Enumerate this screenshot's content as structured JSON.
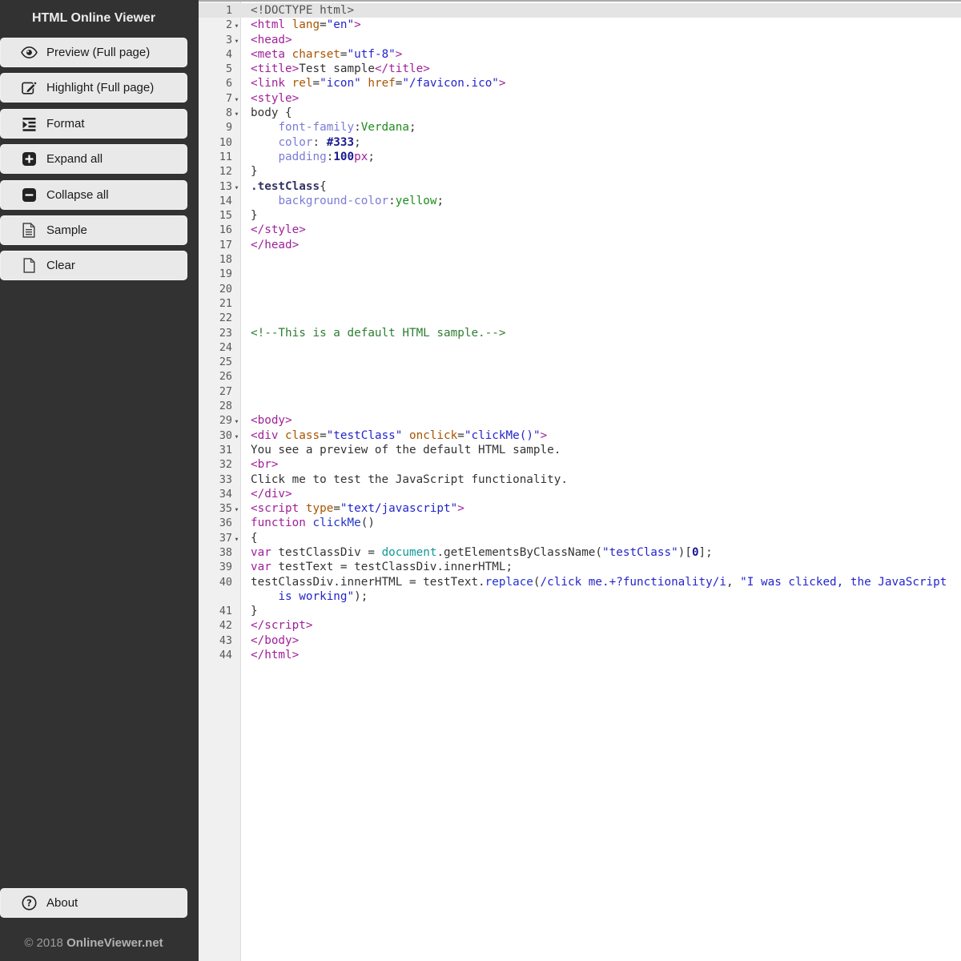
{
  "sidebar": {
    "title": "HTML Online Viewer",
    "buttons": [
      {
        "id": "preview",
        "icon": "eye-icon",
        "label": "Preview (Full page)"
      },
      {
        "id": "highlight",
        "icon": "edit-icon",
        "label": "Highlight (Full page)"
      },
      {
        "id": "format",
        "icon": "format-icon",
        "label": "Format"
      },
      {
        "id": "expand-all",
        "icon": "expand-icon",
        "label": "Expand all"
      },
      {
        "id": "collapse-all",
        "icon": "collapse-icon",
        "label": "Collapse all"
      },
      {
        "id": "sample",
        "icon": "sample-document-icon",
        "label": "Sample"
      },
      {
        "id": "clear",
        "icon": "blank-page-icon",
        "label": "Clear"
      }
    ],
    "about_button": {
      "id": "about",
      "icon": "question-icon",
      "label": "About"
    },
    "copyright": {
      "prefix": "© 2018 ",
      "site": "OnlineViewer.net"
    }
  },
  "editor": {
    "active_line": 1,
    "colors": {
      "tag": "#a0209a",
      "attribute": "#a85400",
      "string": "#2424cc",
      "comment": "#2e7d32",
      "css_property": "#7b7bd8",
      "css_value": "#1e8c1e",
      "number": "#1a1a90",
      "meta": "#555555",
      "selector": "#333366",
      "js_builtin": "#119999",
      "function_name": "#2233cc",
      "active_line_bg": "#e4e4e4",
      "gutter_bg": "#f0f0f0",
      "sidebar_bg": "#323232",
      "button_bg": "#e9e9e9"
    },
    "lines": [
      {
        "n": 1,
        "a": true,
        "t": [
          [
            "meta",
            "<!DOCTYPE html>"
          ]
        ]
      },
      {
        "n": 2,
        "f": true,
        "t": [
          [
            "tag",
            "<html "
          ],
          [
            "attr",
            "lang"
          ],
          [
            "plain",
            "="
          ],
          [
            "str",
            "\"en\""
          ],
          [
            "tag",
            ">"
          ]
        ]
      },
      {
        "n": 3,
        "f": true,
        "t": [
          [
            "tag",
            "<head>"
          ]
        ]
      },
      {
        "n": 4,
        "t": [
          [
            "tag",
            "<meta "
          ],
          [
            "attr",
            "charset"
          ],
          [
            "plain",
            "="
          ],
          [
            "str",
            "\"utf-8\""
          ],
          [
            "tag",
            ">"
          ]
        ]
      },
      {
        "n": 5,
        "t": [
          [
            "tag",
            "<title>"
          ],
          [
            "plain",
            "Test sample"
          ],
          [
            "tag",
            "</title>"
          ]
        ]
      },
      {
        "n": 6,
        "t": [
          [
            "tag",
            "<link "
          ],
          [
            "attr",
            "rel"
          ],
          [
            "plain",
            "="
          ],
          [
            "str",
            "\"icon\""
          ],
          [
            "plain",
            " "
          ],
          [
            "attr",
            "href"
          ],
          [
            "plain",
            "="
          ],
          [
            "str",
            "\"/favicon.ico\""
          ],
          [
            "tag",
            ">"
          ]
        ]
      },
      {
        "n": 7,
        "f": true,
        "t": [
          [
            "tag",
            "<style>"
          ]
        ]
      },
      {
        "n": 8,
        "f": true,
        "t": [
          [
            "plain",
            "body {"
          ]
        ]
      },
      {
        "n": 9,
        "t": [
          [
            "plain",
            "    "
          ],
          [
            "prop",
            "font-family"
          ],
          [
            "plain",
            ":"
          ],
          [
            "val",
            "Verdana"
          ],
          [
            "plain",
            ";"
          ]
        ]
      },
      {
        "n": 10,
        "t": [
          [
            "plain",
            "    "
          ],
          [
            "prop",
            "color"
          ],
          [
            "plain",
            ": "
          ],
          [
            "num",
            "#333"
          ],
          [
            "plain",
            ";"
          ]
        ]
      },
      {
        "n": 11,
        "t": [
          [
            "plain",
            "    "
          ],
          [
            "prop",
            "padding"
          ],
          [
            "plain",
            ":"
          ],
          [
            "num",
            "100"
          ],
          [
            "unit",
            "px"
          ],
          [
            "plain",
            ";"
          ]
        ]
      },
      {
        "n": 12,
        "t": [
          [
            "plain",
            "}"
          ]
        ]
      },
      {
        "n": 13,
        "f": true,
        "t": [
          [
            "sel",
            ".testClass"
          ],
          [
            "plain",
            "{"
          ]
        ]
      },
      {
        "n": 14,
        "t": [
          [
            "plain",
            "    "
          ],
          [
            "prop",
            "background-color"
          ],
          [
            "plain",
            ":"
          ],
          [
            "val",
            "yellow"
          ],
          [
            "plain",
            ";"
          ]
        ]
      },
      {
        "n": 15,
        "t": [
          [
            "plain",
            "}"
          ]
        ]
      },
      {
        "n": 16,
        "t": [
          [
            "tag",
            "</style>"
          ]
        ]
      },
      {
        "n": 17,
        "t": [
          [
            "tag",
            "</head>"
          ]
        ]
      },
      {
        "n": 18,
        "t": []
      },
      {
        "n": 19,
        "t": []
      },
      {
        "n": 20,
        "t": []
      },
      {
        "n": 21,
        "t": []
      },
      {
        "n": 22,
        "t": []
      },
      {
        "n": 23,
        "t": [
          [
            "com",
            "<!--This is a default HTML sample.-->"
          ]
        ]
      },
      {
        "n": 24,
        "t": []
      },
      {
        "n": 25,
        "t": []
      },
      {
        "n": 26,
        "t": []
      },
      {
        "n": 27,
        "t": []
      },
      {
        "n": 28,
        "t": []
      },
      {
        "n": 29,
        "f": true,
        "t": [
          [
            "tag",
            "<body>"
          ]
        ]
      },
      {
        "n": 30,
        "f": true,
        "t": [
          [
            "tag",
            "<div "
          ],
          [
            "attr",
            "class"
          ],
          [
            "plain",
            "="
          ],
          [
            "str",
            "\"testClass\""
          ],
          [
            "plain",
            " "
          ],
          [
            "attr",
            "onclick"
          ],
          [
            "plain",
            "="
          ],
          [
            "str",
            "\"clickMe()\""
          ],
          [
            "tag",
            ">"
          ]
        ]
      },
      {
        "n": 31,
        "t": [
          [
            "plain",
            "You see a preview of the default HTML sample."
          ]
        ]
      },
      {
        "n": 32,
        "t": [
          [
            "tag",
            "<br>"
          ]
        ]
      },
      {
        "n": 33,
        "t": [
          [
            "plain",
            "Click me to test the JavaScript functionality."
          ]
        ]
      },
      {
        "n": 34,
        "t": [
          [
            "tag",
            "</div>"
          ]
        ]
      },
      {
        "n": 35,
        "f": true,
        "t": [
          [
            "tag",
            "<script "
          ],
          [
            "attr",
            "type"
          ],
          [
            "plain",
            "="
          ],
          [
            "str",
            "\"text/javascript\""
          ],
          [
            "tag",
            ">"
          ]
        ]
      },
      {
        "n": 36,
        "t": [
          [
            "kw",
            "function"
          ],
          [
            "plain",
            " "
          ],
          [
            "fn",
            "clickMe"
          ],
          [
            "plain",
            "()"
          ]
        ]
      },
      {
        "n": 37,
        "f": true,
        "t": [
          [
            "plain",
            "{"
          ]
        ]
      },
      {
        "n": 38,
        "t": [
          [
            "kw",
            "var"
          ],
          [
            "plain",
            " testClassDiv = "
          ],
          [
            "var2",
            "document"
          ],
          [
            "plain",
            ".getElementsByClassName("
          ],
          [
            "str",
            "\"testClass\""
          ],
          [
            "plain",
            ")["
          ],
          [
            "num",
            "0"
          ],
          [
            "plain",
            "];"
          ]
        ]
      },
      {
        "n": 39,
        "t": [
          [
            "kw",
            "var"
          ],
          [
            "plain",
            " testText = testClassDiv.innerHTML;"
          ]
        ]
      },
      {
        "n": 40,
        "t": [
          [
            "plain",
            "testClassDiv.innerHTML = testText."
          ],
          [
            "fn",
            "replace"
          ],
          [
            "plain",
            "("
          ],
          [
            "str",
            "/click me.+?functionality/i"
          ],
          [
            "plain",
            ", "
          ],
          [
            "str",
            "\"I was clicked, the JavaScript"
          ]
        ]
      },
      {
        "n": "",
        "wrap": true,
        "t": [
          [
            "plain",
            "    "
          ],
          [
            "str",
            "is working\""
          ],
          [
            "plain",
            ");"
          ]
        ]
      },
      {
        "n": 41,
        "t": [
          [
            "plain",
            "}"
          ]
        ]
      },
      {
        "n": 42,
        "t": [
          [
            "tag",
            "</script>"
          ]
        ]
      },
      {
        "n": 43,
        "t": [
          [
            "tag",
            "</body>"
          ]
        ]
      },
      {
        "n": 44,
        "t": [
          [
            "tag",
            "</html>"
          ]
        ]
      }
    ]
  }
}
